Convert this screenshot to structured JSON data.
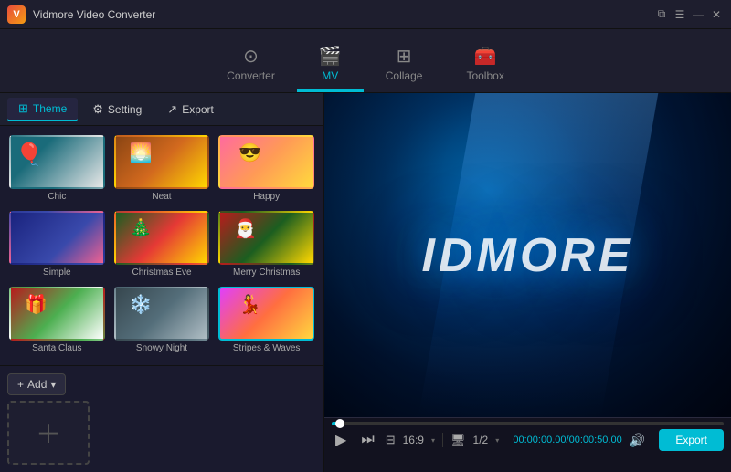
{
  "app": {
    "title": "Vidmore Video Converter",
    "icon": "V"
  },
  "window_controls": {
    "restore": "⧉",
    "minimize": "—",
    "close": "✕",
    "menu": "☰"
  },
  "nav": {
    "tabs": [
      {
        "id": "converter",
        "label": "Converter",
        "icon": "⊙"
      },
      {
        "id": "mv",
        "label": "MV",
        "icon": "🎬"
      },
      {
        "id": "collage",
        "label": "Collage",
        "icon": "⊞"
      },
      {
        "id": "toolbox",
        "label": "Toolbox",
        "icon": "🧰"
      }
    ],
    "active": "mv"
  },
  "sub_tabs": [
    {
      "id": "theme",
      "label": "Theme",
      "icon": "⊞"
    },
    {
      "id": "setting",
      "label": "Setting",
      "icon": "⚙"
    },
    {
      "id": "export",
      "label": "Export",
      "icon": "↗"
    }
  ],
  "sub_tab_active": "theme",
  "themes": [
    {
      "id": "chic",
      "label": "Chic",
      "class": "thumb-chic"
    },
    {
      "id": "neat",
      "label": "Neat",
      "class": "thumb-neat"
    },
    {
      "id": "happy",
      "label": "Happy",
      "class": "thumb-happy"
    },
    {
      "id": "simple",
      "label": "Simple",
      "class": "thumb-simple"
    },
    {
      "id": "christmas-eve",
      "label": "Christmas Eve",
      "class": "thumb-xmas-eve"
    },
    {
      "id": "merry-christmas",
      "label": "Merry Christmas",
      "class": "thumb-merry"
    },
    {
      "id": "santa-claus",
      "label": "Santa Claus",
      "class": "thumb-santa"
    },
    {
      "id": "snowy-night",
      "label": "Snowy Night",
      "class": "thumb-snowy"
    },
    {
      "id": "stripes-waves",
      "label": "Stripes & Waves",
      "class": "thumb-stripes",
      "selected": true
    }
  ],
  "add_button": {
    "label": "Add",
    "arrow": "▾"
  },
  "preview": {
    "watermark": "IDMORE"
  },
  "player": {
    "play_icon": "▶",
    "next_icon": "⏭",
    "time_current": "00:00:00.00",
    "time_total": "00:00:50.00",
    "time_separator": "/",
    "volume_icon": "🔊",
    "aspect_ratio": "16:9",
    "page": "1/2",
    "export_label": "Export"
  }
}
